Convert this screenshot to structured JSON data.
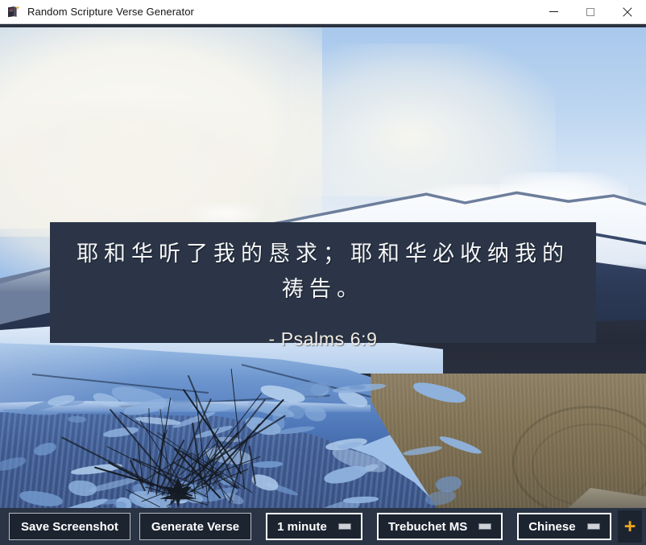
{
  "window": {
    "title": "Random Scripture Verse Generator",
    "icon": "book-sparkle-icon",
    "controls": {
      "minimize_label": "Minimize",
      "maximize_label": "Maximize",
      "close_label": "Close"
    }
  },
  "verse": {
    "text": "耶和华听了我的恳求；耶和华必收纳我的祷告。",
    "reference": "- Psalms 6:9"
  },
  "background": {
    "description": "Glacier and snow-capped mountain landscape"
  },
  "toolbar": {
    "save_screenshot_label": "Save Screenshot",
    "generate_verse_label": "Generate Verse",
    "interval_value": "1 minute",
    "font_value": "Trebuchet MS",
    "language_value": "Chinese",
    "add_label": "+"
  },
  "colors": {
    "panel_background": "#2b3547",
    "toolbar_background": "#2b3445",
    "button_background": "#1c2430",
    "accent": "#f0a81e",
    "text": "#ffffff"
  }
}
